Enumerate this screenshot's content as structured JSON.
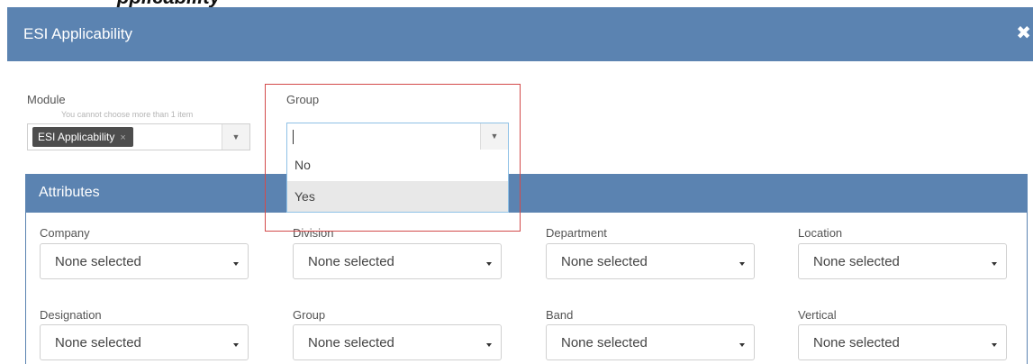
{
  "background_snippet": "pplicability",
  "modal": {
    "title": "ESI Applicability",
    "close_icon": "close-icon"
  },
  "module": {
    "label": "Module",
    "hint": "You cannot choose more than 1 item",
    "selected_tag": "ESI Applicability",
    "tag_remove": "×"
  },
  "group_top": {
    "label": "Group",
    "value": "",
    "options": [
      "No",
      "Yes"
    ],
    "highlighted_option": "Yes"
  },
  "attributes": {
    "title": "Attributes",
    "fields": [
      {
        "label": "Company",
        "value": "None selected"
      },
      {
        "label": "Division",
        "value": "None selected"
      },
      {
        "label": "Department",
        "value": "None selected"
      },
      {
        "label": "Location",
        "value": "None selected"
      },
      {
        "label": "Designation",
        "value": "None selected"
      },
      {
        "label": "Group",
        "value": "None selected"
      },
      {
        "label": "Band",
        "value": "None selected"
      },
      {
        "label": "Vertical",
        "value": "None selected"
      }
    ]
  },
  "colors": {
    "header_blue": "#5b83b1",
    "highlight_red": "#d34b4b",
    "focus_border": "#8fc1e6"
  }
}
